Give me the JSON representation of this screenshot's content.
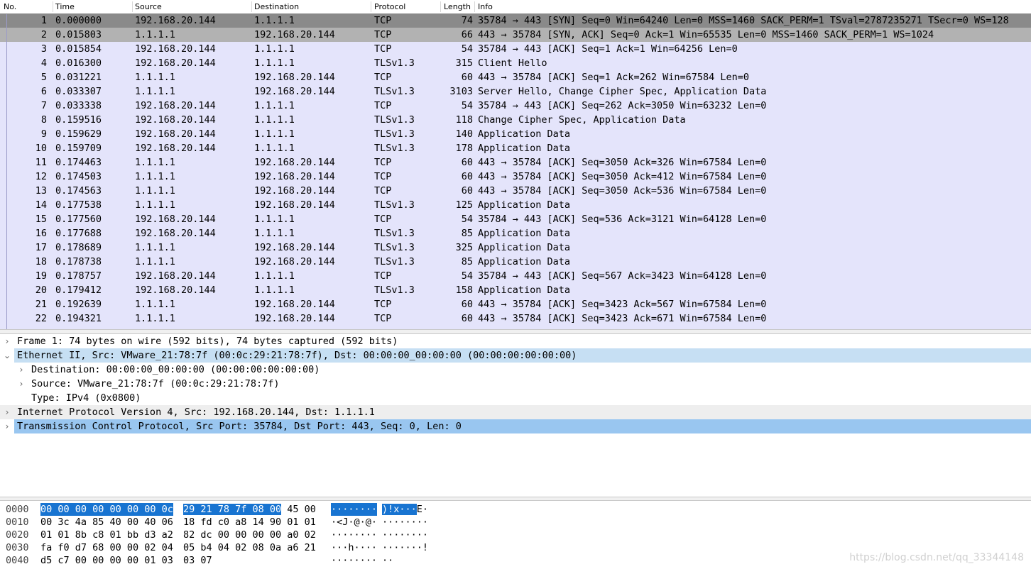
{
  "columns": {
    "no": "No.",
    "time": "Time",
    "source": "Source",
    "destination": "Destination",
    "protocol": "Protocol",
    "length": "Length",
    "info": "Info"
  },
  "packets": [
    {
      "no": "1",
      "time": "0.000000",
      "src": "192.168.20.144",
      "dst": "1.1.1.1",
      "proto": "TCP",
      "len": "74",
      "info": "35784 → 443 [SYN] Seq=0 Win=64240 Len=0 MSS=1460 SACK_PERM=1 TSval=2787235271 TSecr=0 WS=128"
    },
    {
      "no": "2",
      "time": "0.015803",
      "src": "1.1.1.1",
      "dst": "192.168.20.144",
      "proto": "TCP",
      "len": "66",
      "info": "443 → 35784 [SYN, ACK] Seq=0 Ack=1 Win=65535 Len=0 MSS=1460 SACK_PERM=1 WS=1024"
    },
    {
      "no": "3",
      "time": "0.015854",
      "src": "192.168.20.144",
      "dst": "1.1.1.1",
      "proto": "TCP",
      "len": "54",
      "info": "35784 → 443 [ACK] Seq=1 Ack=1 Win=64256 Len=0"
    },
    {
      "no": "4",
      "time": "0.016300",
      "src": "192.168.20.144",
      "dst": "1.1.1.1",
      "proto": "TLSv1.3",
      "len": "315",
      "info": "Client Hello"
    },
    {
      "no": "5",
      "time": "0.031221",
      "src": "1.1.1.1",
      "dst": "192.168.20.144",
      "proto": "TCP",
      "len": "60",
      "info": "443 → 35784 [ACK] Seq=1 Ack=262 Win=67584 Len=0"
    },
    {
      "no": "6",
      "time": "0.033307",
      "src": "1.1.1.1",
      "dst": "192.168.20.144",
      "proto": "TLSv1.3",
      "len": "3103",
      "info": "Server Hello, Change Cipher Spec, Application Data"
    },
    {
      "no": "7",
      "time": "0.033338",
      "src": "192.168.20.144",
      "dst": "1.1.1.1",
      "proto": "TCP",
      "len": "54",
      "info": "35784 → 443 [ACK] Seq=262 Ack=3050 Win=63232 Len=0"
    },
    {
      "no": "8",
      "time": "0.159516",
      "src": "192.168.20.144",
      "dst": "1.1.1.1",
      "proto": "TLSv1.3",
      "len": "118",
      "info": "Change Cipher Spec, Application Data"
    },
    {
      "no": "9",
      "time": "0.159629",
      "src": "192.168.20.144",
      "dst": "1.1.1.1",
      "proto": "TLSv1.3",
      "len": "140",
      "info": "Application Data"
    },
    {
      "no": "10",
      "time": "0.159709",
      "src": "192.168.20.144",
      "dst": "1.1.1.1",
      "proto": "TLSv1.3",
      "len": "178",
      "info": "Application Data"
    },
    {
      "no": "11",
      "time": "0.174463",
      "src": "1.1.1.1",
      "dst": "192.168.20.144",
      "proto": "TCP",
      "len": "60",
      "info": "443 → 35784 [ACK] Seq=3050 Ack=326 Win=67584 Len=0"
    },
    {
      "no": "12",
      "time": "0.174503",
      "src": "1.1.1.1",
      "dst": "192.168.20.144",
      "proto": "TCP",
      "len": "60",
      "info": "443 → 35784 [ACK] Seq=3050 Ack=412 Win=67584 Len=0"
    },
    {
      "no": "13",
      "time": "0.174563",
      "src": "1.1.1.1",
      "dst": "192.168.20.144",
      "proto": "TCP",
      "len": "60",
      "info": "443 → 35784 [ACK] Seq=3050 Ack=536 Win=67584 Len=0"
    },
    {
      "no": "14",
      "time": "0.177538",
      "src": "1.1.1.1",
      "dst": "192.168.20.144",
      "proto": "TLSv1.3",
      "len": "125",
      "info": "Application Data"
    },
    {
      "no": "15",
      "time": "0.177560",
      "src": "192.168.20.144",
      "dst": "1.1.1.1",
      "proto": "TCP",
      "len": "54",
      "info": "35784 → 443 [ACK] Seq=536 Ack=3121 Win=64128 Len=0"
    },
    {
      "no": "16",
      "time": "0.177688",
      "src": "192.168.20.144",
      "dst": "1.1.1.1",
      "proto": "TLSv1.3",
      "len": "85",
      "info": "Application Data"
    },
    {
      "no": "17",
      "time": "0.178689",
      "src": "1.1.1.1",
      "dst": "192.168.20.144",
      "proto": "TLSv1.3",
      "len": "325",
      "info": "Application Data"
    },
    {
      "no": "18",
      "time": "0.178738",
      "src": "1.1.1.1",
      "dst": "192.168.20.144",
      "proto": "TLSv1.3",
      "len": "85",
      "info": "Application Data"
    },
    {
      "no": "19",
      "time": "0.178757",
      "src": "192.168.20.144",
      "dst": "1.1.1.1",
      "proto": "TCP",
      "len": "54",
      "info": "35784 → 443 [ACK] Seq=567 Ack=3423 Win=64128 Len=0"
    },
    {
      "no": "20",
      "time": "0.179412",
      "src": "192.168.20.144",
      "dst": "1.1.1.1",
      "proto": "TLSv1.3",
      "len": "158",
      "info": "Application Data"
    },
    {
      "no": "21",
      "time": "0.192639",
      "src": "1.1.1.1",
      "dst": "192.168.20.144",
      "proto": "TCP",
      "len": "60",
      "info": "443 → 35784 [ACK] Seq=3423 Ack=567 Win=67584 Len=0"
    },
    {
      "no": "22",
      "time": "0.194321",
      "src": "1.1.1.1",
      "dst": "192.168.20.144",
      "proto": "TCP",
      "len": "60",
      "info": "443 → 35784 [ACK] Seq=3423 Ack=671 Win=67584 Len=0"
    }
  ],
  "details": {
    "frame": "Frame 1: 74 bytes on wire (592 bits), 74 bytes captured (592 bits)",
    "ethernet": "Ethernet II, Src: VMware_21:78:7f (00:0c:29:21:78:7f), Dst: 00:00:00_00:00:00 (00:00:00:00:00:00)",
    "eth_destination": "Destination: 00:00:00_00:00:00 (00:00:00:00:00:00)",
    "eth_source": "Source: VMware_21:78:7f (00:0c:29:21:78:7f)",
    "eth_type": "Type: IPv4 (0x0800)",
    "ipv4": "Internet Protocol Version 4, Src: 192.168.20.144, Dst: 1.1.1.1",
    "tcp": "Transmission Control Protocol, Src Port: 35784, Dst Port: 443, Seq: 0, Len: 0"
  },
  "hex": {
    "rows": [
      {
        "offset": "0000",
        "a": "00 00 00 00 00 00 00 0c",
        "b_sel": "29 21 78 7f 08 00",
        "b_rest": " 45 00",
        "ascii_a": "········",
        "ascii_b_sel": ")!x···",
        "ascii_b_rest": "E·"
      },
      {
        "offset": "0010",
        "a": "00 3c 4a 85 40 00 40 06",
        "b_sel": "",
        "b_rest": "18 fd c0 a8 14 90 01 01",
        "ascii_a": "·<J·@·@·",
        "ascii_b_sel": "",
        "ascii_b_rest": "········"
      },
      {
        "offset": "0020",
        "a": "01 01 8b c8 01 bb d3 a2",
        "b_sel": "",
        "b_rest": "82 dc 00 00 00 00 a0 02",
        "ascii_a": "········",
        "ascii_b_sel": "",
        "ascii_b_rest": "········"
      },
      {
        "offset": "0030",
        "a": "fa f0 d7 68 00 00 02 04",
        "b_sel": "",
        "b_rest": "05 b4 04 02 08 0a a6 21",
        "ascii_a": "···h····",
        "ascii_b_sel": "",
        "ascii_b_rest": "·······!"
      },
      {
        "offset": "0040",
        "a": "d5 c7 00 00 00 00 01 03",
        "b_sel": "",
        "b_rest": "03 07",
        "ascii_a": "········",
        "ascii_b_sel": "",
        "ascii_b_rest": "··"
      }
    ]
  },
  "watermark": "https://blog.csdn.net/qq_33344148",
  "colors": {
    "row_bg": "#e4e4fb",
    "selected_row": "#8a8a8a",
    "related_row": "#b2b2b2",
    "tree_selected": "#99c6f0",
    "tree_highlight": "#c6dff3",
    "hex_selection": "#1874d1"
  },
  "icons": {
    "collapsed": "chevron-right-icon",
    "expanded": "chevron-down-icon"
  }
}
